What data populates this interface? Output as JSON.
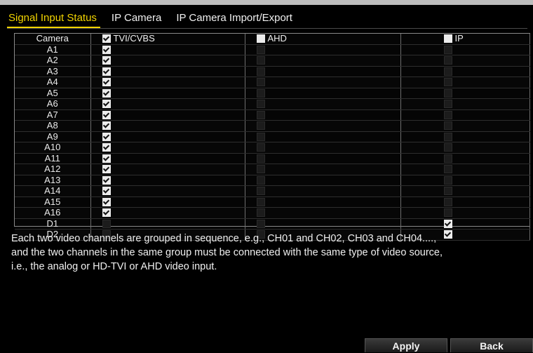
{
  "tabs": [
    {
      "label": "Signal Input Status",
      "active": true
    },
    {
      "label": "IP Camera",
      "active": false
    },
    {
      "label": "IP Camera Import/Export",
      "active": false
    }
  ],
  "table": {
    "headers": {
      "camera": "Camera",
      "tvi": "TVI/CVBS",
      "ahd": "AHD",
      "ip": "IP"
    },
    "header_checked": {
      "tvi": true,
      "ahd": false,
      "ip": false
    },
    "rows": [
      {
        "camera": "A1",
        "tvi": true,
        "ahd": false,
        "ip": false
      },
      {
        "camera": "A2",
        "tvi": true,
        "ahd": false,
        "ip": false
      },
      {
        "camera": "A3",
        "tvi": true,
        "ahd": false,
        "ip": false
      },
      {
        "camera": "A4",
        "tvi": true,
        "ahd": false,
        "ip": false
      },
      {
        "camera": "A5",
        "tvi": true,
        "ahd": false,
        "ip": false
      },
      {
        "camera": "A6",
        "tvi": true,
        "ahd": false,
        "ip": false
      },
      {
        "camera": "A7",
        "tvi": true,
        "ahd": false,
        "ip": false
      },
      {
        "camera": "A8",
        "tvi": true,
        "ahd": false,
        "ip": false
      },
      {
        "camera": "A9",
        "tvi": true,
        "ahd": false,
        "ip": false
      },
      {
        "camera": "A10",
        "tvi": true,
        "ahd": false,
        "ip": false
      },
      {
        "camera": "A11",
        "tvi": true,
        "ahd": false,
        "ip": false
      },
      {
        "camera": "A12",
        "tvi": true,
        "ahd": false,
        "ip": false
      },
      {
        "camera": "A13",
        "tvi": true,
        "ahd": false,
        "ip": false
      },
      {
        "camera": "A14",
        "tvi": true,
        "ahd": false,
        "ip": false
      },
      {
        "camera": "A15",
        "tvi": true,
        "ahd": false,
        "ip": false
      },
      {
        "camera": "A16",
        "tvi": true,
        "ahd": false,
        "ip": false
      },
      {
        "camera": "D1",
        "tvi": false,
        "ahd": false,
        "ip": true
      },
      {
        "camera": "D2",
        "tvi": false,
        "ahd": false,
        "ip": true
      }
    ]
  },
  "note": {
    "line1": "Each two video channels are grouped in sequence, e.g., CH01 and CH02, CH03 and CH04....,",
    "line2": "and the two channels in the same group must be connected with the same type of video source,",
    "line3": "i.e., the analog or HD-TVI or AHD video input."
  },
  "buttons": {
    "apply": "Apply",
    "back": "Back"
  },
  "colors": {
    "accent": "#f2d400",
    "background": "#000000"
  }
}
